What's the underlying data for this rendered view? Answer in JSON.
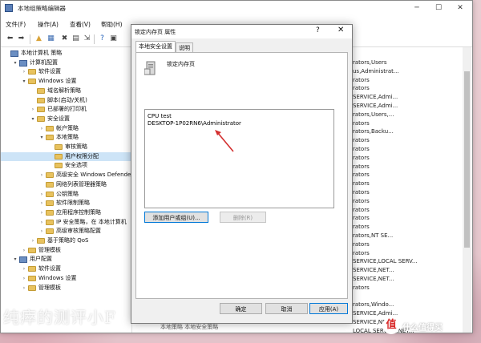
{
  "window": {
    "title": "本地组策略编辑器",
    "controls": [
      "─",
      "☐",
      "✕"
    ]
  },
  "menu": [
    "文件(F)",
    "操作(A)",
    "查看(V)",
    "帮助(H)"
  ],
  "tree": [
    {
      "label": "本地计算机 策略",
      "indent": 0,
      "toggle": "",
      "icon": "pc"
    },
    {
      "label": "计算机配置",
      "indent": 1,
      "toggle": "▾",
      "icon": "pc"
    },
    {
      "label": "软件设置",
      "indent": 2,
      "toggle": "›",
      "icon": "folder"
    },
    {
      "label": "Windows 设置",
      "indent": 2,
      "toggle": "▾",
      "icon": "folder"
    },
    {
      "label": "域名解析策略",
      "indent": 3,
      "toggle": "",
      "icon": "folder"
    },
    {
      "label": "脚本(启动/关机)",
      "indent": 3,
      "toggle": "",
      "icon": "folder"
    },
    {
      "label": "已部署的打印机",
      "indent": 3,
      "toggle": "›",
      "icon": "folder"
    },
    {
      "label": "安全设置",
      "indent": 3,
      "toggle": "▾",
      "icon": "folder"
    },
    {
      "label": "帐户策略",
      "indent": 4,
      "toggle": "›",
      "icon": "folder"
    },
    {
      "label": "本地策略",
      "indent": 4,
      "toggle": "▾",
      "icon": "folder"
    },
    {
      "label": "审核策略",
      "indent": 5,
      "toggle": "",
      "icon": "folder"
    },
    {
      "label": "用户权限分配",
      "indent": 5,
      "toggle": "",
      "icon": "folder",
      "selected": true
    },
    {
      "label": "安全选项",
      "indent": 5,
      "toggle": "",
      "icon": "folder"
    },
    {
      "label": "高级安全 Windows Defender",
      "indent": 4,
      "toggle": "›",
      "icon": "folder"
    },
    {
      "label": "网络列表管理器策略",
      "indent": 4,
      "toggle": "",
      "icon": "folder"
    },
    {
      "label": "公钥策略",
      "indent": 4,
      "toggle": "›",
      "icon": "folder"
    },
    {
      "label": "软件限制策略",
      "indent": 4,
      "toggle": "›",
      "icon": "folder"
    },
    {
      "label": "应用程序控制策略",
      "indent": 4,
      "toggle": "›",
      "icon": "folder"
    },
    {
      "label": "IP 安全策略，在 本地计算机",
      "indent": 4,
      "toggle": "›",
      "icon": "folder"
    },
    {
      "label": "高级审核策略配置",
      "indent": 4,
      "toggle": "›",
      "icon": "folder"
    },
    {
      "label": "基于策略的 QoS",
      "indent": 3,
      "toggle": "›",
      "icon": "folder"
    },
    {
      "label": "管理模板",
      "indent": 2,
      "toggle": "›",
      "icon": "folder"
    },
    {
      "label": "用户配置",
      "indent": 1,
      "toggle": "▾",
      "icon": "pc"
    },
    {
      "label": "软件设置",
      "indent": 2,
      "toggle": "›",
      "icon": "folder"
    },
    {
      "label": "Windows 设置",
      "indent": 2,
      "toggle": "›",
      "icon": "folder"
    },
    {
      "label": "管理模板",
      "indent": 2,
      "toggle": "›",
      "icon": "folder"
    }
  ],
  "right_list": [
    "rators,Users",
    "us,Administrat...",
    "rators",
    "rators",
    "SERVICE,Admi...",
    "SERVICE,Admi...",
    "rators,Users,...",
    "rators",
    "rators,Backu...",
    "rators",
    "rators",
    "rators",
    "rators",
    "rators",
    "rators",
    "rators",
    "rators",
    "rators",
    "rators",
    "rators",
    "rators,NT SE...",
    "rators",
    "rators",
    "SERVICE,LOCAL SERV...",
    "SERVICE,NET...",
    "SERVICE,NET...",
    "rators",
    "",
    "rators,Windo...",
    "SERVICE,Admi...",
    "SERVICE,NET...",
    "LOCAL SERVICE,NET..."
  ],
  "dialog": {
    "title": "锁定内存页 属性",
    "help": "?",
    "close": "✕",
    "tabs": [
      "本地安全设置",
      "说明"
    ],
    "policy_name": "锁定内存页",
    "entries": [
      "CPU test",
      "DESKTOP-1P02RN6\\Administrator"
    ],
    "add_button": "添加用户或组(U)...",
    "remove_button": "删除(R)",
    "ok": "确定",
    "cancel": "取消",
    "apply": "应用(A)"
  },
  "behind_text": "本地策略 本地安全策略",
  "watermark": "纯瘁的测评小F",
  "logo": {
    "badge": "值",
    "text": "什么值得买"
  },
  "colors": {
    "selection": "#cde4f7",
    "arrow": "#d32f2f",
    "focus": "#0078d7"
  }
}
